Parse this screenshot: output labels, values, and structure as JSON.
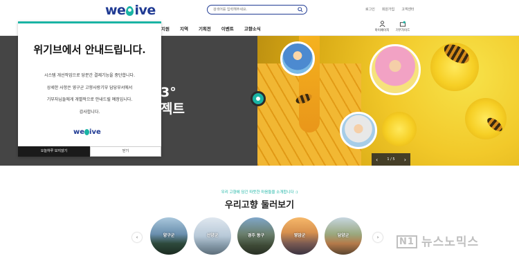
{
  "header": {
    "logo": "we",
    "logo_tail": "ive",
    "search_placeholder": "검색어를 입력해주세요.",
    "top_links": [
      "로그인",
      "회원가입",
      "고객센터"
    ],
    "gnb": [
      "지원",
      "지역",
      "기획전",
      "이벤트",
      "고향소식"
    ],
    "util": [
      {
        "label": "마이페이지",
        "icon": "user-icon"
      },
      {
        "label": "기부가이드",
        "icon": "guide-icon"
      }
    ]
  },
  "hero": {
    "title_line1": "3°",
    "title_line2": "젝트",
    "slider": {
      "prev": "‹",
      "counter": "1 / 5",
      "next": "›"
    }
  },
  "popup": {
    "title": "위기브에서 안내드립니다.",
    "body": [
      "시스템 개선작업으로 당분간 결제기능을 중단합니다.",
      "상세한 사항은 영구군 고향사랑기부 담당부서에서",
      "기부자님들에게 개별적으로 안내드릴 예정입니다.",
      "감사합니다."
    ],
    "logo": "we",
    "logo_tail": "ive",
    "btn_dismiss_today": "오늘하루 보지않기",
    "btn_close": "닫기"
  },
  "section": {
    "subtitle": "우리 고향에 담긴 따뜻한 마음들을 소개합니다 :)",
    "title": "우리고향 둘러보기",
    "regions": [
      "양구군",
      "선양군",
      "경주 동구",
      "영암군",
      "담양군"
    ],
    "prev": "‹",
    "next": "›"
  },
  "watermark": {
    "box": "N1",
    "text": "뉴스노믹스"
  },
  "colors": {
    "brand_navy": "#1f3a93",
    "accent_teal": "#1ab4a4",
    "hero_dark": "#454545"
  }
}
